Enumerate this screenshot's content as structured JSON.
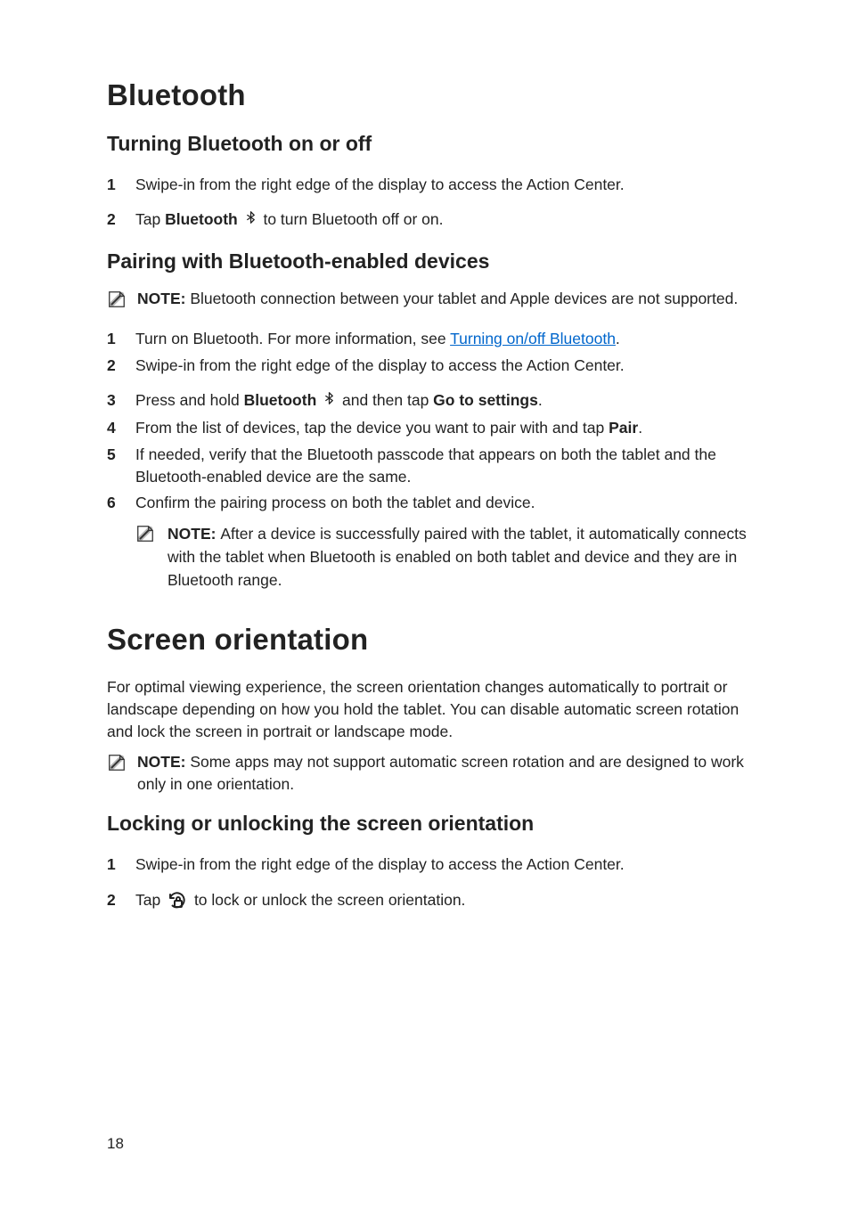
{
  "sections": {
    "bluetooth": {
      "title": "Bluetooth",
      "toggle": {
        "heading": "Turning Bluetooth on or off",
        "steps": {
          "n1": "1",
          "s1": "Swipe-in from the right edge of the display to access the Action Center.",
          "n2": "2",
          "s2a": "Tap ",
          "s2b": "Bluetooth ",
          "s2c": " to turn Bluetooth off or on."
        }
      },
      "pairing": {
        "heading": "Pairing with Bluetooth-enabled devices",
        "note1_label": "NOTE: ",
        "note1_body": "Bluetooth connection between your tablet and Apple devices are not supported.",
        "steps": {
          "n1": "1",
          "s1a": "Turn on Bluetooth. For more information, see ",
          "s1link": "Turning on/off Bluetooth",
          "s1b": ".",
          "n2": "2",
          "s2": "Swipe-in from the right edge of the display to access the Action Center.",
          "n3": "3",
          "s3a": "Press and hold ",
          "s3b": "Bluetooth ",
          "s3c": " and then tap ",
          "s3d": "Go to settings",
          "s3e": ".",
          "n4": "4",
          "s4a": "From the list of devices, tap the device you want to pair with and tap ",
          "s4b": "Pair",
          "s4c": ".",
          "n5": "5",
          "s5": "If needed, verify that the Bluetooth passcode that appears on both the tablet and the Bluetooth-enabled device are the same.",
          "n6": "6",
          "s6": "Confirm the pairing process on both the tablet and device."
        },
        "note2_label": "NOTE: ",
        "note2_body": "After a device is successfully paired with the tablet, it automatically connects with the tablet when Bluetooth is enabled on both tablet and device and they are in Bluetooth range."
      }
    },
    "orientation": {
      "title": "Screen orientation",
      "intro": "For optimal viewing experience, the screen orientation changes automatically to portrait or landscape depending on how you hold the tablet. You can disable automatic screen rotation and lock the screen in portrait or landscape mode.",
      "note_label": "NOTE: ",
      "note_body": "Some apps may not support automatic screen rotation and are designed to work only in one orientation.",
      "locking": {
        "heading": "Locking or unlocking the screen orientation",
        "steps": {
          "n1": "1",
          "s1": "Swipe-in from the right edge of the display to access the Action Center.",
          "n2": "2",
          "s2a": "Tap ",
          "s2b": " to lock or unlock the screen orientation."
        }
      }
    }
  },
  "page_number": "18"
}
